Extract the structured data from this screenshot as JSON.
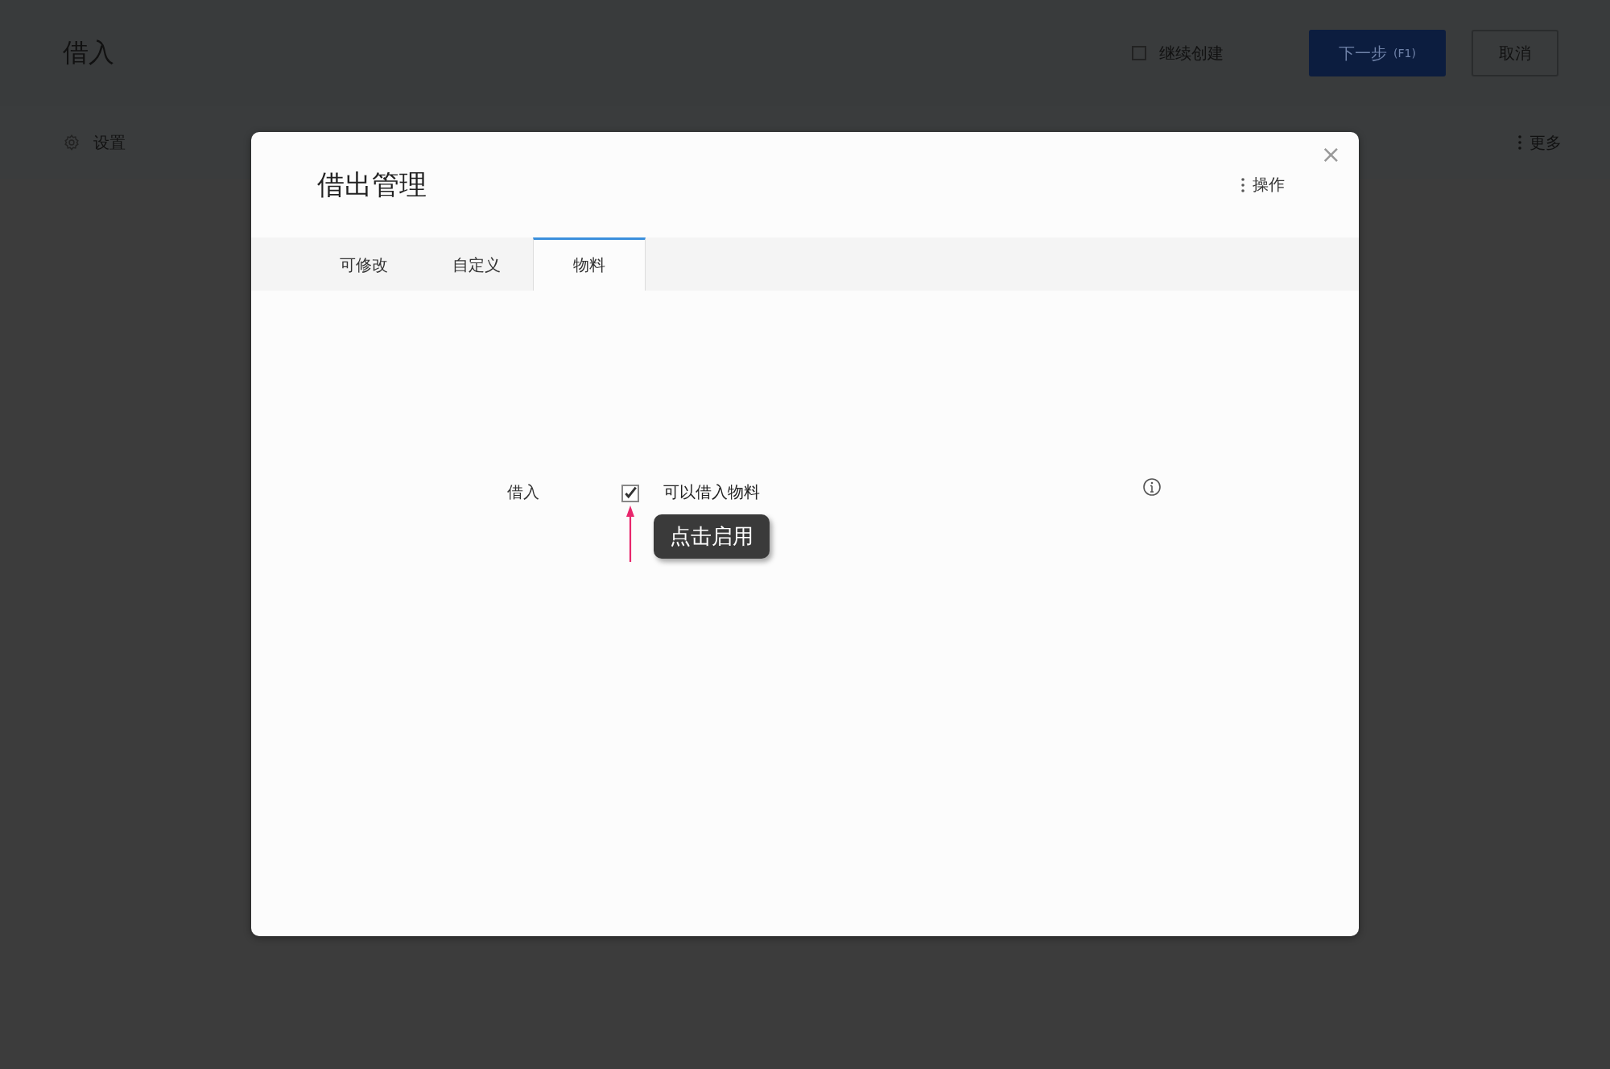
{
  "page": {
    "title": "借入",
    "continue_create": {
      "label": "继续创建",
      "checked": false
    },
    "buttons": [
      {
        "label": "下一步",
        "shortcut": "(F1)",
        "kind": "primary"
      },
      {
        "label": "取消",
        "kind": "secondary"
      }
    ],
    "settings_label": "设置",
    "more_label": "更多"
  },
  "dialog": {
    "title": "借出管理",
    "actions_label": "操作",
    "close": "×",
    "tabs": [
      {
        "label": "可修改",
        "selected": false
      },
      {
        "label": "自定义",
        "selected": false
      },
      {
        "label": "物料",
        "selected": true
      }
    ],
    "field": {
      "label": "借入",
      "checked": true,
      "option_label": "可以借入物料"
    },
    "tooltip": "点击启用"
  }
}
